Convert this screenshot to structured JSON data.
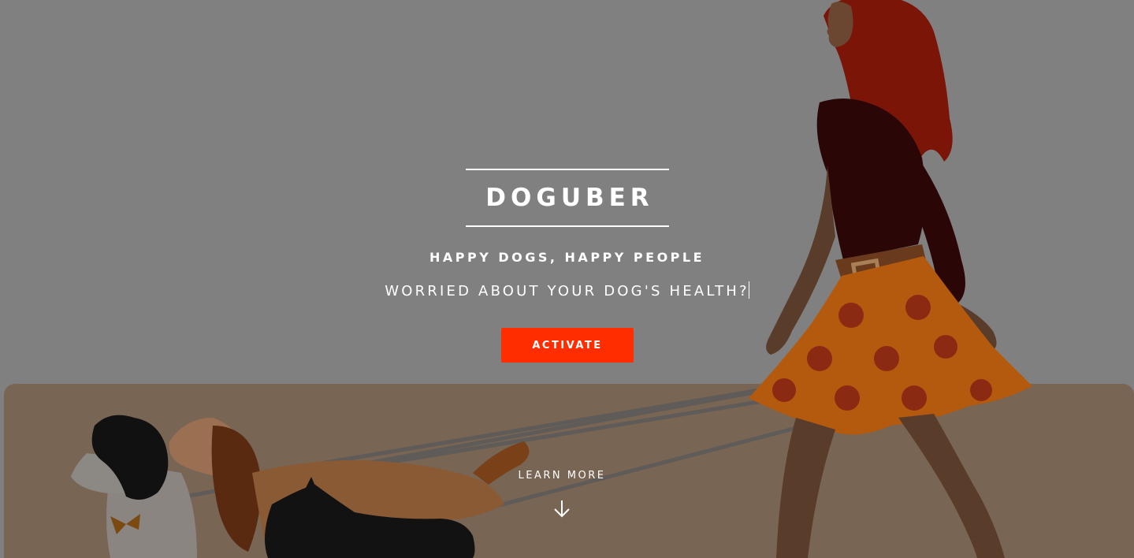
{
  "hero": {
    "brand": "DOGUBER",
    "tagline": "HAPPY DOGS, HAPPY PEOPLE",
    "typed_text": "WORRIED ABOUT YOUR DOG'S HEALTH?",
    "activate_label": "ACTIVATE",
    "learn_more_label": "LEARN MORE",
    "arrow_icon": "arrow-down-icon"
  },
  "colors": {
    "overlay": "#808080",
    "accent": "#ff2d00",
    "text": "#ffffff"
  }
}
